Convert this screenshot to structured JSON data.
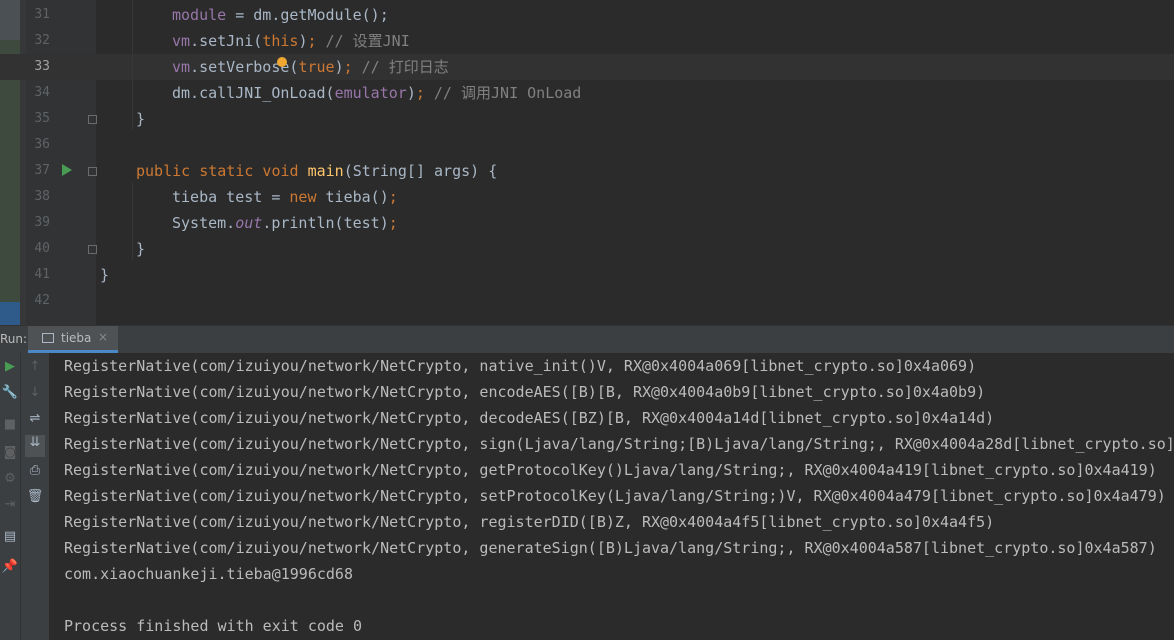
{
  "editor": {
    "lines": [
      {
        "n": "31",
        "indent": 2,
        "tokens": [
          {
            "t": "module",
            "c": "purple"
          },
          {
            "t": " = dm.getModule();",
            "c": "plain"
          }
        ]
      },
      {
        "n": "32",
        "indent": 2,
        "tokens": [
          {
            "t": "vm",
            "c": "purple"
          },
          {
            "t": ".setJni(",
            "c": "plain"
          },
          {
            "t": "this",
            "c": "kw"
          },
          {
            "t": ")",
            "c": "plain"
          },
          {
            "t": "; ",
            "c": "kw"
          },
          {
            "t": "// ",
            "c": "comment"
          },
          {
            "t": "设置",
            "c": "comment-cjk"
          },
          {
            "t": "JNI",
            "c": "comment"
          }
        ]
      },
      {
        "n": "33",
        "indent": 2,
        "tokens": [
          {
            "t": "vm",
            "c": "purple"
          },
          {
            "t": ".setVerbose(",
            "c": "plain"
          },
          {
            "t": "true",
            "c": "kw"
          },
          {
            "t": ")",
            "c": "plain"
          },
          {
            "t": "; ",
            "c": "kw"
          },
          {
            "t": "// ",
            "c": "comment"
          },
          {
            "t": "打印日志",
            "c": "comment-cjk"
          }
        ]
      },
      {
        "n": "34",
        "indent": 2,
        "tokens": [
          {
            "t": "dm.callJNI_OnLoad(",
            "c": "plain"
          },
          {
            "t": "emulator",
            "c": "purple"
          },
          {
            "t": ")",
            "c": "plain"
          },
          {
            "t": "; ",
            "c": "kw"
          },
          {
            "t": "// ",
            "c": "comment"
          },
          {
            "t": "调用",
            "c": "comment-cjk"
          },
          {
            "t": "JNI OnLoad",
            "c": "comment"
          }
        ]
      },
      {
        "n": "35",
        "indent": 1,
        "tokens": [
          {
            "t": "}",
            "c": "plain"
          }
        ]
      },
      {
        "n": "36",
        "indent": 0,
        "tokens": []
      },
      {
        "n": "37",
        "indent": 1,
        "tokens": [
          {
            "t": "public static void ",
            "c": "kw"
          },
          {
            "t": "main",
            "c": "fn"
          },
          {
            "t": "(String[] args) {",
            "c": "plain"
          }
        ]
      },
      {
        "n": "38",
        "indent": 2,
        "tokens": [
          {
            "t": "tieba test = ",
            "c": "plain"
          },
          {
            "t": "new ",
            "c": "kw"
          },
          {
            "t": "tieba()",
            "c": "plain"
          },
          {
            "t": ";",
            "c": "kw"
          }
        ]
      },
      {
        "n": "39",
        "indent": 2,
        "tokens": [
          {
            "t": "System.",
            "c": "plain"
          },
          {
            "t": "out",
            "c": "italic-purple"
          },
          {
            "t": ".println(test)",
            "c": "plain"
          },
          {
            "t": ";",
            "c": "kw"
          }
        ]
      },
      {
        "n": "40",
        "indent": 1,
        "tokens": [
          {
            "t": "}",
            "c": "plain"
          }
        ]
      },
      {
        "n": "41",
        "indent": 0,
        "tokens": [
          {
            "t": "}",
            "c": "plain"
          }
        ]
      },
      {
        "n": "42",
        "indent": 0,
        "tokens": []
      }
    ],
    "current_line": "33"
  },
  "run": {
    "label": "Run:",
    "tab_label": "tieba",
    "tab_close": "×"
  },
  "toolbar": {
    "icons": [
      "run-icon",
      "wrench-icon",
      "stop-icon",
      "camera-icon",
      "settings-icon",
      "exit-icon",
      "layout-icon",
      "pin-icon"
    ],
    "icons2": [
      "up-arrow-icon",
      "down-arrow-icon",
      "soft-wrap-icon",
      "scroll-to-end-icon",
      "print-icon",
      "trash-icon"
    ]
  },
  "console": {
    "lines": [
      "RegisterNative(com/izuiyou/network/NetCrypto, native_init()V, RX@0x4004a069[libnet_crypto.so]0x4a069)",
      "RegisterNative(com/izuiyou/network/NetCrypto, encodeAES([B)[B, RX@0x4004a0b9[libnet_crypto.so]0x4a0b9)",
      "RegisterNative(com/izuiyou/network/NetCrypto, decodeAES([BZ)[B, RX@0x4004a14d[libnet_crypto.so]0x4a14d)",
      "RegisterNative(com/izuiyou/network/NetCrypto, sign(Ljava/lang/String;[B)Ljava/lang/String;, RX@0x4004a28d[libnet_crypto.so]0",
      "RegisterNative(com/izuiyou/network/NetCrypto, getProtocolKey()Ljava/lang/String;, RX@0x4004a419[libnet_crypto.so]0x4a419)",
      "RegisterNative(com/izuiyou/network/NetCrypto, setProtocolKey(Ljava/lang/String;)V, RX@0x4004a479[libnet_crypto.so]0x4a479)",
      "RegisterNative(com/izuiyou/network/NetCrypto, registerDID([B)Z, RX@0x4004a4f5[libnet_crypto.so]0x4a4f5)",
      "RegisterNative(com/izuiyou/network/NetCrypto, generateSign([B)Ljava/lang/String;, RX@0x4004a587[libnet_crypto.so]0x4a587)",
      "com.xiaochuankeji.tieba@1996cd68",
      "",
      "Process finished with exit code 0"
    ]
  }
}
